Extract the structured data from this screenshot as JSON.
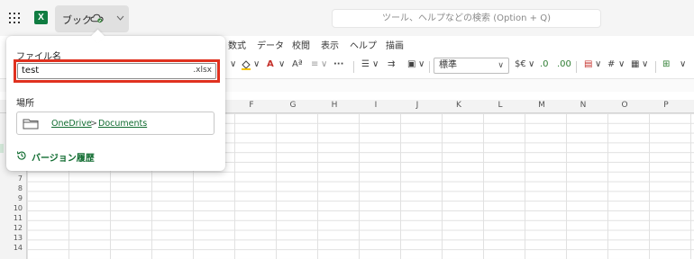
{
  "titlebar": {
    "app_icon": "excel-icon",
    "doc_name": "ブック",
    "cloud_icon": "cloud-sync-icon",
    "search_placeholder": "ツール、ヘルプなどの検索 (Option + Q)"
  },
  "ribbon": {
    "tabs": [
      "数式",
      "データ",
      "校閲",
      "表示",
      "ヘルプ",
      "描画"
    ],
    "toolbar_items": [
      "∨",
      "A",
      "∨",
      "A",
      "∨",
      "Aª",
      "∨",
      "···",
      "∨",
      "∨",
      "∨",
      "$€",
      "∨",
      ".0",
      ".00",
      "∨",
      "#",
      "∨",
      "∨",
      "∨"
    ],
    "number_format": "標準"
  },
  "grid": {
    "columns": [
      "F",
      "G",
      "H",
      "I",
      "J",
      "K",
      "L",
      "M",
      "N",
      "O",
      "P"
    ],
    "rows": [
      "7",
      "8",
      "9",
      "10",
      "11",
      "12",
      "13",
      "14"
    ],
    "selection_color": "#d2e7d8"
  },
  "panel": {
    "file_name_label": "ファイル名",
    "file_name_value": "test",
    "extension": ".xlsx",
    "location_label": "場所",
    "location_path": [
      "OneDrive",
      "Documents"
    ],
    "path_separator": ">",
    "version_history": "バージョン履歴",
    "highlight_color": "#e0311f",
    "accent_color": "#0f6b2f"
  }
}
